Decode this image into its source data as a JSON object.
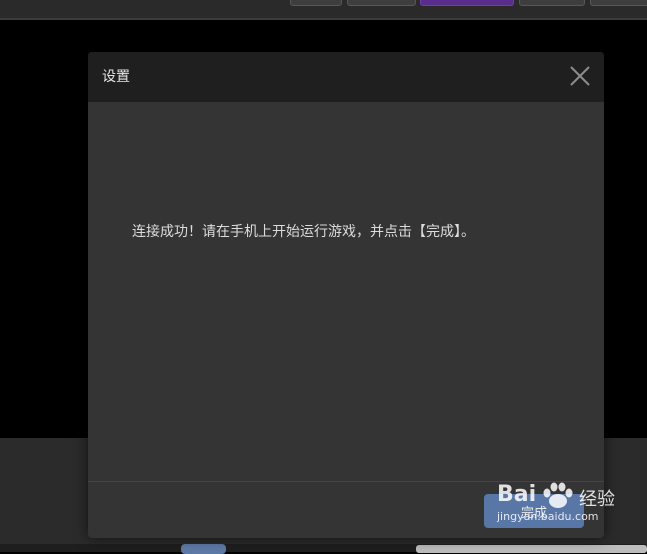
{
  "dialog": {
    "title": "设置",
    "message": "连接成功！请在手机上开始运行游戏，并点击【完成】。",
    "done_label": "完成"
  },
  "watermark": {
    "logo_text": "Bai",
    "logo_text_cn": "经验",
    "url": "jingyan.baidu.com"
  },
  "colors": {
    "dialog_bg": "#343434",
    "header_bg": "#1f1f1f",
    "accent_button": "#5876a6",
    "active_tab": "#5a2d8c"
  },
  "icons": {
    "close": "close-icon",
    "watermark": "paw-icon"
  }
}
